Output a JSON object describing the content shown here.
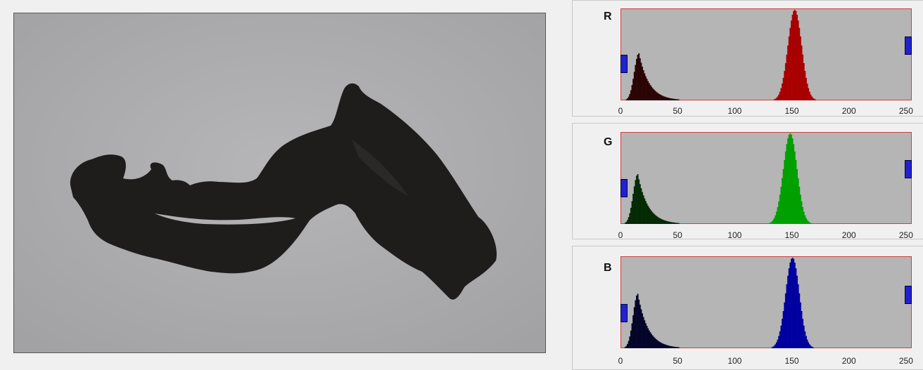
{
  "image_panel": {
    "description_icon": "photo-icon"
  },
  "histograms": [
    {
      "channel": "R",
      "color": "#a80000",
      "dark_color": "#2a0505",
      "ticks": [
        "0",
        "50",
        "100",
        "150",
        "200",
        "250"
      ],
      "low_peak": {
        "center": 15,
        "height": 0.52
      },
      "high_peak": {
        "center": 152,
        "height": 1.0
      },
      "low_marker": 0,
      "high_marker": 255
    },
    {
      "channel": "G",
      "color": "#00a000",
      "dark_color": "#052a05",
      "ticks": [
        "0",
        "50",
        "100",
        "150",
        "200",
        "250"
      ],
      "low_peak": {
        "center": 14,
        "height": 0.55
      },
      "high_peak": {
        "center": 148,
        "height": 1.0
      },
      "low_marker": 0,
      "high_marker": 255
    },
    {
      "channel": "B",
      "color": "#0000a0",
      "dark_color": "#05052a",
      "ticks": [
        "0",
        "50",
        "100",
        "150",
        "200",
        "250"
      ],
      "low_peak": {
        "center": 14,
        "height": 0.6
      },
      "high_peak": {
        "center": 150,
        "height": 1.0
      },
      "low_marker": 0,
      "high_marker": 255
    }
  ]
}
